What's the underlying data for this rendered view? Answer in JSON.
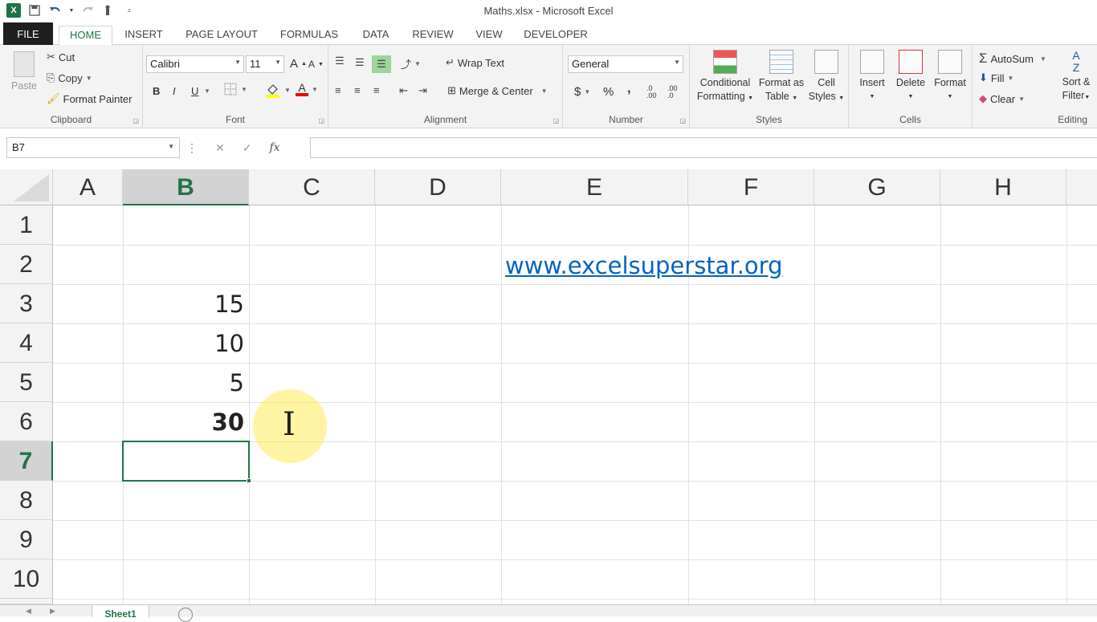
{
  "window": {
    "title": "Maths.xlsx - Microsoft Excel"
  },
  "qat": {
    "logo": "X",
    "save_icon": "save-icon",
    "undo_icon": "undo-icon",
    "redo_icon": "redo-icon",
    "touch_icon": "touch-mode-icon",
    "customize_icon": "customize-icon"
  },
  "tabs": [
    "FILE",
    "HOME",
    "INSERT",
    "PAGE LAYOUT",
    "FORMULAS",
    "DATA",
    "REVIEW",
    "VIEW",
    "DEVELOPER"
  ],
  "ribbon": {
    "clipboard": {
      "label": "Clipboard",
      "paste": "Paste",
      "cut": "Cut",
      "copy": "Copy",
      "format_painter": "Format Painter"
    },
    "font": {
      "label": "Font",
      "name": "Calibri",
      "size": "11",
      "grow": "A",
      "shrink": "A",
      "bold": "B",
      "italic": "I",
      "underline": "U",
      "font_color": "A"
    },
    "alignment": {
      "label": "Alignment",
      "wrap_text": "Wrap Text",
      "merge_center": "Merge & Center"
    },
    "number": {
      "label": "Number",
      "format": "General",
      "currency": "$",
      "percent": "%",
      "comma": ",",
      "inc_decimal": ".0 .00",
      "dec_decimal": ".00 .0"
    },
    "styles": {
      "label": "Styles",
      "conditional_1": "Conditional",
      "conditional_2": "Formatting",
      "format_as_1": "Format as",
      "format_as_2": "Table",
      "cell_styles_1": "Cell",
      "cell_styles_2": "Styles"
    },
    "cells": {
      "label": "Cells",
      "insert": "Insert",
      "delete": "Delete",
      "format": "Format"
    },
    "editing": {
      "label": "Editing",
      "autosum": "AutoSum",
      "fill": "Fill",
      "clear": "Clear",
      "sort_1": "Sort &",
      "sort_2": "Filter"
    }
  },
  "formula_bar": {
    "name_box": "B7",
    "cancel": "✕",
    "enter": "✓",
    "fx": "fx",
    "content": ""
  },
  "columns": [
    "A",
    "B",
    "C",
    "D",
    "E",
    "F",
    "G",
    "H"
  ],
  "rows": [
    "1",
    "2",
    "3",
    "4",
    "5",
    "6",
    "7",
    "8",
    "9",
    "10"
  ],
  "cells": {
    "E2": "www.excelsuperstar.org",
    "B3": "15",
    "B4": "10",
    "B5": "5",
    "B6": "30"
  },
  "selected": {
    "cell": "B7",
    "column": "B",
    "row": "7"
  },
  "sheets": {
    "active": "Sheet1"
  },
  "colors": {
    "accent": "#217346",
    "link": "#0563c1",
    "highlight": "#ffeb5a"
  }
}
